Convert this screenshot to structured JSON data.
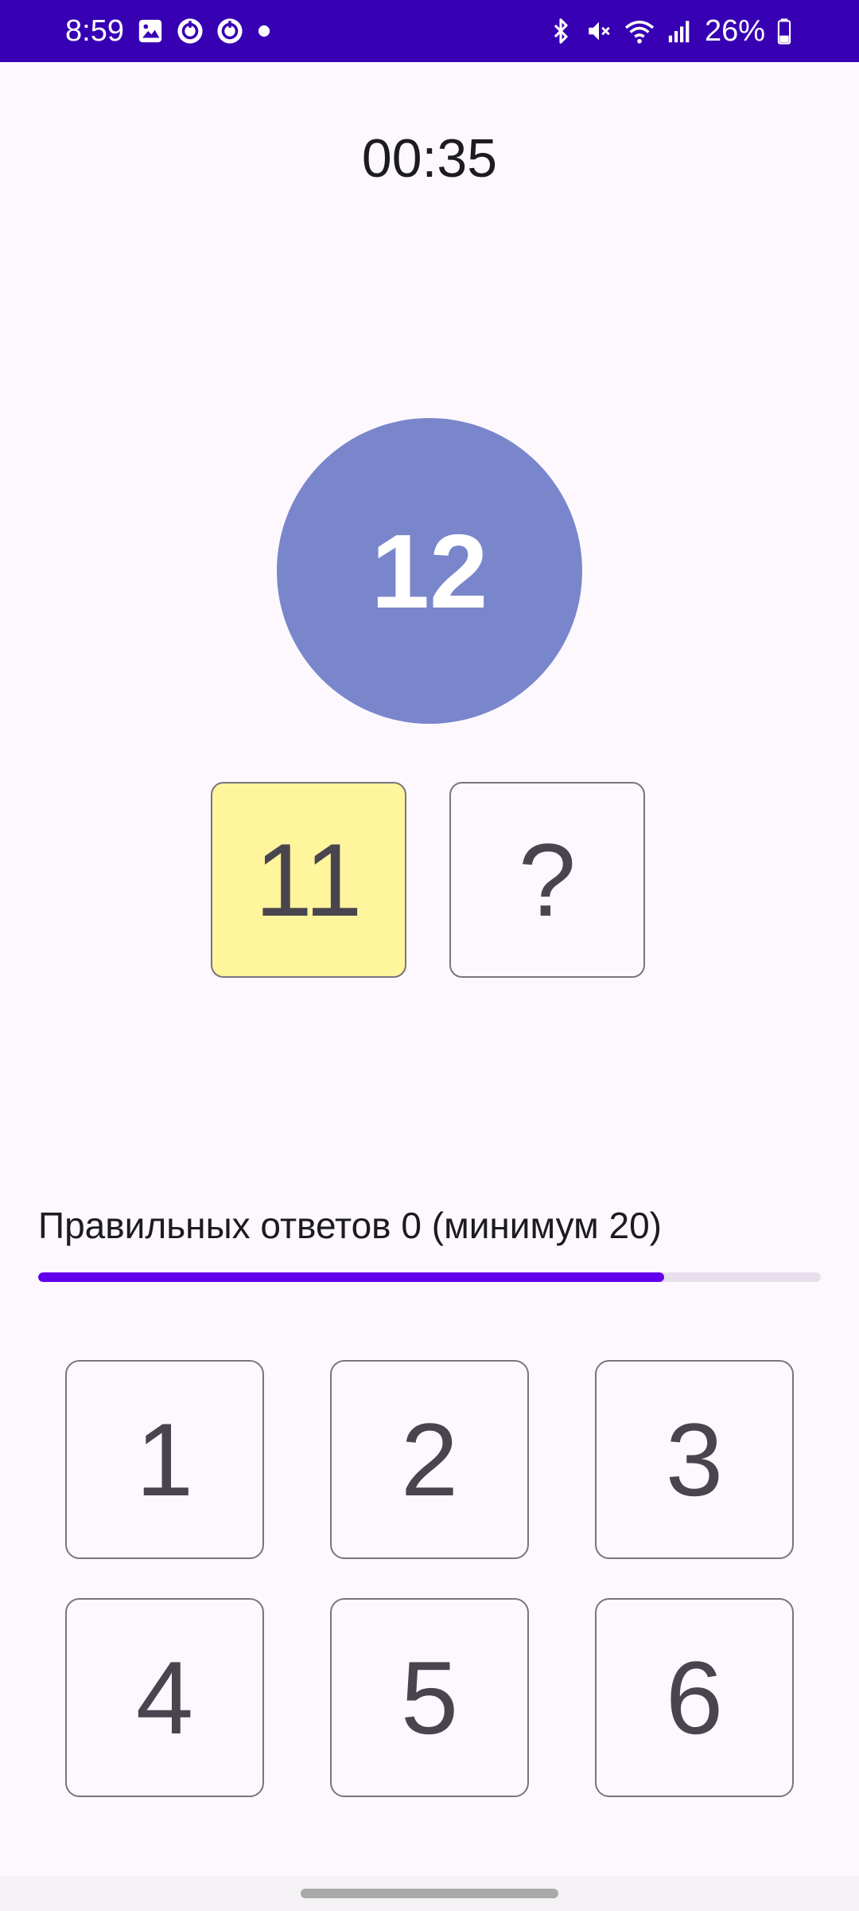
{
  "status_bar": {
    "time": "8:59",
    "battery": "26%",
    "left_icons": [
      "gallery-icon",
      "app-notification-icon",
      "app-notification-icon",
      "dot-icon"
    ],
    "right_icons": [
      "bluetooth-icon",
      "mute-icon",
      "wifi-icon",
      "signal-icon",
      "battery-icon"
    ],
    "background_color": "#3700b3"
  },
  "game": {
    "timer": "00:35",
    "target_number": "12",
    "target_color": "#7986cb",
    "answer_slots": [
      {
        "value": "11",
        "highlight_color": "#fff59d"
      },
      {
        "value": "?"
      }
    ]
  },
  "progress": {
    "label": "Правильных ответов 0 (минимум 20)",
    "fill_fraction": 0.8,
    "fill_color": "#6200ee"
  },
  "keypad": {
    "keys": [
      "1",
      "2",
      "3",
      "4",
      "5",
      "6"
    ]
  }
}
